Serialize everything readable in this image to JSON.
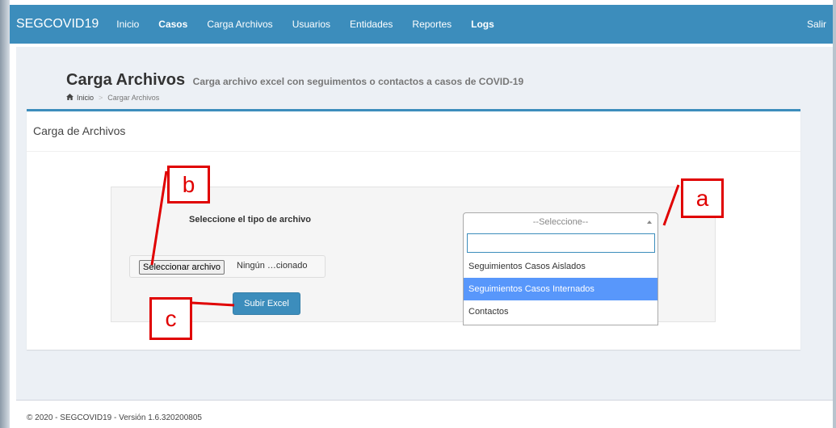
{
  "navbar": {
    "brand": "SEGCOVID19",
    "items": [
      {
        "label": "Inicio",
        "bold": false
      },
      {
        "label": "Casos",
        "bold": true
      },
      {
        "label": "Carga Archivos",
        "bold": false
      },
      {
        "label": "Usuarios",
        "bold": false
      },
      {
        "label": "Entidades",
        "bold": false
      },
      {
        "label": "Reportes",
        "bold": false
      },
      {
        "label": "Logs",
        "bold": true
      }
    ],
    "logout": "Salir"
  },
  "header": {
    "title": "Carga Archivos",
    "subtitle": "Carga archivo excel con seguimentos o contactos a casos de COVID-19"
  },
  "breadcrumb": {
    "home": "Inicio",
    "current": "Cargar Archivos",
    "home_icon": "home-icon"
  },
  "box": {
    "title": "Carga de Archivos"
  },
  "form": {
    "tipo_label": "Seleccione el tipo de archivo",
    "file_button": "Seleccionar archivo",
    "file_status": "Ningún …cionado",
    "submit": "Subir Excel",
    "select": {
      "placeholder": "--Seleccione--",
      "search_value": "",
      "options": [
        {
          "label": "Seguimientos Casos Aislados",
          "highlighted": false
        },
        {
          "label": "Seguimientos Casos Internados",
          "highlighted": true
        },
        {
          "label": "Contactos",
          "highlighted": false
        }
      ]
    }
  },
  "annotations": {
    "a": "a",
    "b": "b",
    "c": "c",
    "color": "#e00000"
  },
  "footer": {
    "text": "© 2020 - SEGCOVID19 - Versión 1.6.320200805"
  },
  "colors": {
    "primary": "#3c8dbc",
    "content_bg": "#ecf0f5",
    "highlight": "#5897fb"
  }
}
